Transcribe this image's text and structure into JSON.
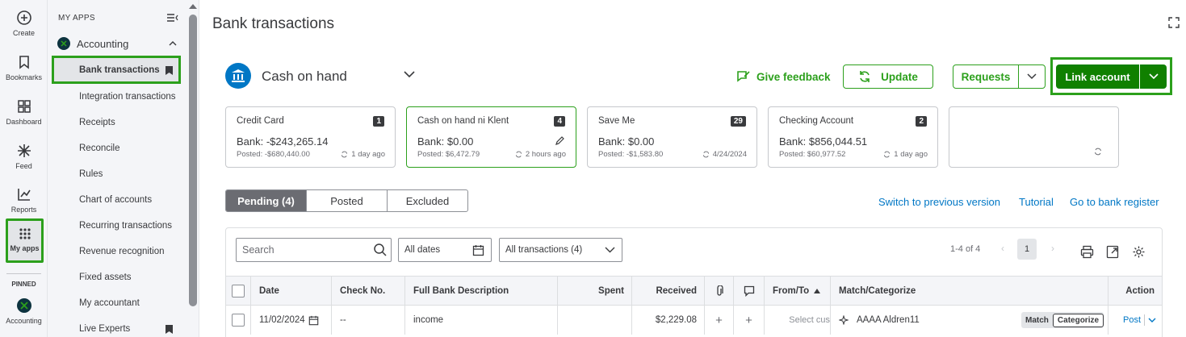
{
  "rail": {
    "items": [
      {
        "label": "Create",
        "icon": "plus-circle-icon"
      },
      {
        "label": "Bookmarks",
        "icon": "bookmark-icon"
      },
      {
        "label": "Dashboard",
        "icon": "dashboard-icon"
      },
      {
        "label": "Feed",
        "icon": "feed-icon"
      },
      {
        "label": "Reports",
        "icon": "reports-icon"
      },
      {
        "label": "My apps",
        "icon": "apps-grid-icon"
      }
    ],
    "pinned_label": "PINNED",
    "pinned_app": "Accounting"
  },
  "sidebar": {
    "heading": "MY APPS",
    "app_name": "Accounting",
    "items": [
      {
        "label": "Bank transactions",
        "active": true,
        "bookmarked": true
      },
      {
        "label": "Integration transactions"
      },
      {
        "label": "Receipts"
      },
      {
        "label": "Reconcile"
      },
      {
        "label": "Rules"
      },
      {
        "label": "Chart of accounts"
      },
      {
        "label": "Recurring transactions"
      },
      {
        "label": "Revenue recognition"
      },
      {
        "label": "Fixed assets"
      },
      {
        "label": "My accountant"
      },
      {
        "label": "Live Experts",
        "bookmarked": true
      }
    ]
  },
  "page": {
    "title": "Bank transactions",
    "account_name": "Cash on hand",
    "feedback_label": "Give feedback",
    "update_label": "Update",
    "requests_label": "Requests",
    "link_account_label": "Link account"
  },
  "cards": [
    {
      "name": "Credit Card",
      "count": "1",
      "bank": "Bank: -$243,265.14",
      "posted": "Posted: -$680,440.00",
      "sync": "1 day ago"
    },
    {
      "name": "Cash on hand ni Klent",
      "count": "4",
      "bank": "Bank: $0.00",
      "posted": "Posted: $6,472.79",
      "sync": "2 hours ago"
    },
    {
      "name": "Save Me",
      "count": "29",
      "bank": "Bank: $0.00",
      "posted": "Posted: -$1,583.80",
      "sync": "4/24/2024"
    },
    {
      "name": "Checking Account",
      "count": "2",
      "bank": "Bank: $856,044.51",
      "posted": "Posted: $60,977.52",
      "sync": "1 day ago"
    }
  ],
  "tabs": [
    "Pending (4)",
    "Posted",
    "Excluded"
  ],
  "links": {
    "switch": "Switch to previous version",
    "tutorial": "Tutorial",
    "register": "Go to bank register"
  },
  "filters": {
    "search_placeholder": "Search",
    "dates": "All dates",
    "transactions": "All transactions (4)"
  },
  "pager": {
    "range": "1-4 of 4",
    "page": "1"
  },
  "table": {
    "headers": {
      "date": "Date",
      "check": "Check No.",
      "desc": "Full Bank Description",
      "spent": "Spent",
      "received": "Received",
      "from_to": "From/To",
      "match": "Match/Categorize",
      "action": "Action"
    },
    "rows": [
      {
        "date": "11/02/2024",
        "check": "--",
        "desc": "income",
        "spent": "",
        "received": "$2,229.08",
        "attach": "+",
        "comment": "+",
        "from_to": "Select cus",
        "match": "AAAA Aldren11",
        "match_label": "Match",
        "categorize_label": "Categorize",
        "action": "Post"
      }
    ]
  },
  "colors": {
    "brand_green": "#2ca01c",
    "button_green": "#108000",
    "link_blue": "#0077c5",
    "highlight_border": "#2ca01c"
  }
}
